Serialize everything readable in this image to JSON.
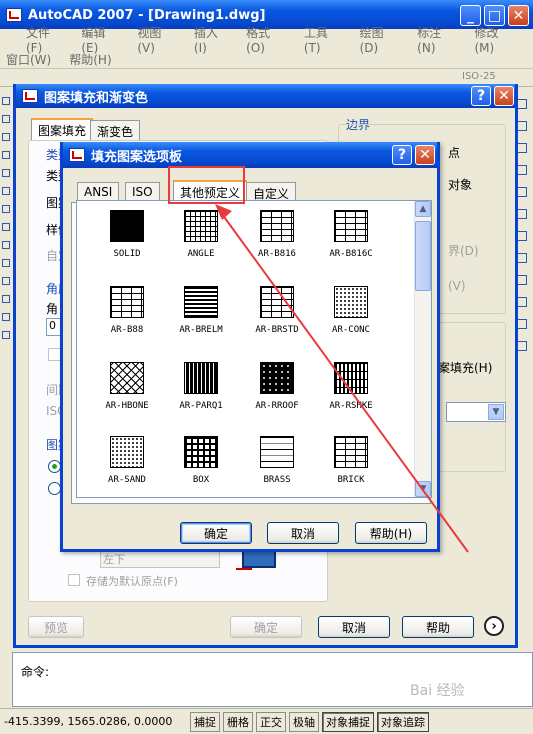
{
  "app": {
    "title": "AutoCAD 2007 - [Drawing1.dwg]",
    "menu_row1": [
      "文件(F)",
      "编辑(E)",
      "视图(V)",
      "插入(I)",
      "格式(O)",
      "工具(T)",
      "绘图(D)",
      "标注(N)",
      "修改(M)"
    ],
    "menu_row2": [
      "窗口(W)",
      "帮助(H)"
    ],
    "command_prompt": "命令:",
    "coords": "-415.3399, 1565.0286, 0.0000",
    "status_buttons": [
      "捕捉",
      "栅格",
      "正交",
      "极轴",
      "对象捕捉",
      "对象追踪"
    ],
    "iso_label": "ISO-25"
  },
  "hatch_dialog": {
    "title": "图案填充和渐变色",
    "tabs": [
      "图案填充",
      "渐变色"
    ],
    "group_type": "类型",
    "type_label": "类型",
    "pattern_label": "图案",
    "sample_label": "样例",
    "custom_label": "自定义",
    "angle_group": "角度",
    "angle_label": "角",
    "angle_value": "0",
    "spacing_label": "间距",
    "iso_label": "ISO",
    "origin_group": "图案",
    "origin_value": "左下",
    "store_default_origin": "存储为默认原点(F)",
    "boundary_group": "边界",
    "boundary_1": "点",
    "boundary_2": "对象",
    "boundary_3": "界(D)",
    "boundary_4": "(V)",
    "fill_option": "案填充(H)",
    "btn_preview": "预览",
    "btn_ok": "确定",
    "btn_cancel": "取消",
    "btn_help": "帮助"
  },
  "pattern_dialog": {
    "title": "填充图案选项板",
    "tabs": [
      "ANSI",
      "ISO",
      "其他预定义",
      "自定义"
    ],
    "active_tab": 2,
    "patterns": [
      "SOLID",
      "ANGLE",
      "AR-B816",
      "AR-B816C",
      "AR-B88",
      "AR-BRELM",
      "AR-BRSTD",
      "AR-CONC",
      "AR-HBONE",
      "AR-PARQ1",
      "AR-RROOF",
      "AR-RSHKE",
      "AR-SAND",
      "BOX",
      "BRASS",
      "BRICK"
    ],
    "btn_ok": "确定",
    "btn_cancel": "取消",
    "btn_help": "帮助(H)"
  },
  "colors": {
    "xp_blue": "#0842d0",
    "highlight_red": "#e93b3b"
  },
  "watermark": "Bai 经验"
}
